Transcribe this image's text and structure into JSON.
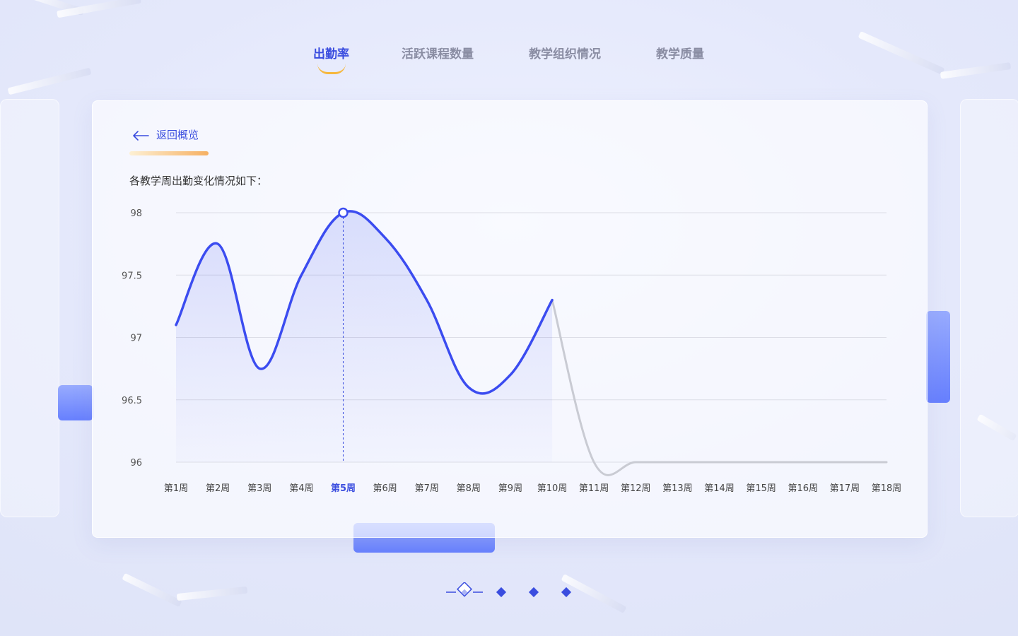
{
  "tabs": [
    {
      "label": "出勤率",
      "active": true
    },
    {
      "label": "活跃课程数量",
      "active": false
    },
    {
      "label": "教学组织情况",
      "active": false
    },
    {
      "label": "教学质量",
      "active": false
    }
  ],
  "panel": {
    "back_label": "返回概览",
    "subtitle": "各教学周出勤变化情况如下："
  },
  "colors": {
    "accent": "#3a4ddf",
    "line": "#3b4cf0",
    "inactive_line": "#c9cbd3",
    "underline": "#f6b73c"
  },
  "chart_data": {
    "type": "line",
    "categories": [
      "第1周",
      "第2周",
      "第3周",
      "第4周",
      "第5周",
      "第6周",
      "第7周",
      "第8周",
      "第9周",
      "第10周",
      "第11周",
      "第12周",
      "第13周",
      "第14周",
      "第15周",
      "第16周",
      "第17周",
      "第18周"
    ],
    "values": [
      97.1,
      97.75,
      96.75,
      97.5,
      98.0,
      97.8,
      97.3,
      96.6,
      96.7,
      97.3,
      96.0,
      96.0,
      96.0,
      96.0,
      96.0,
      96.0,
      96.0,
      96.0
    ],
    "active_until_index": 9,
    "highlight_index": 4,
    "yticks": [
      "98",
      "97.5",
      "97",
      "96.5",
      "96"
    ],
    "ylim": [
      96,
      98
    ],
    "grid": true
  },
  "pager": {
    "count": 4,
    "current": 0
  }
}
